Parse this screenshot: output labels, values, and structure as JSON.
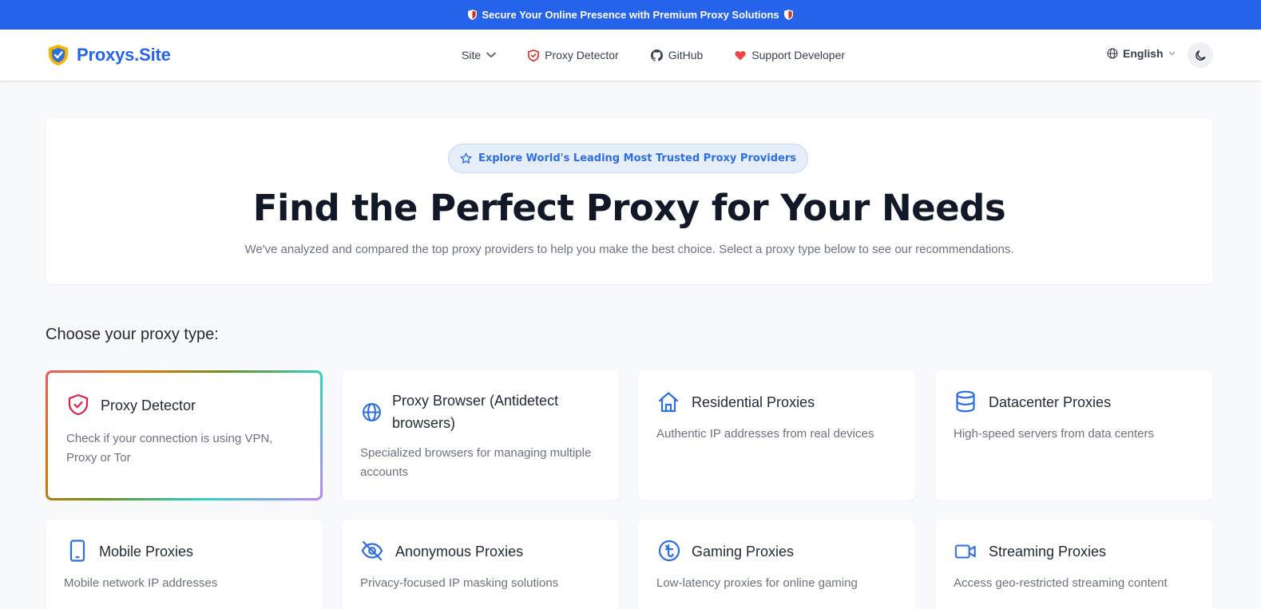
{
  "announcement": {
    "text": "Secure Your Online Presence with Premium Proxy Solutions"
  },
  "nav": {
    "brand": "Proxys.Site",
    "links": [
      {
        "label": "Site",
        "icon": "chevron-down-icon"
      },
      {
        "label": "Proxy Detector",
        "icon": "shield-icon"
      },
      {
        "label": "GitHub",
        "icon": "github-icon"
      },
      {
        "label": "Support Developer",
        "icon": "heart-icon"
      }
    ],
    "language": "English",
    "theme_icon": "moon-icon"
  },
  "hero": {
    "badge": "Explore World's Leading Most Trusted Proxy Providers",
    "title": "Find the Perfect Proxy for Your Needs",
    "subtitle": "We've analyzed and compared the top proxy providers to help you make the best choice. Select a proxy type below to see our recommendations."
  },
  "section_title": "Choose your proxy type:",
  "cards": [
    {
      "title": "Proxy Detector",
      "desc": "Check if your connection is using VPN, Proxy or Tor",
      "icon": "shield-check-icon"
    },
    {
      "title": "Proxy Browser (Antidetect browsers)",
      "desc": "Specialized browsers for managing multiple accounts",
      "icon": "globe-icon"
    },
    {
      "title": "Residential Proxies",
      "desc": "Authentic IP addresses from real devices",
      "icon": "home-icon"
    },
    {
      "title": "Datacenter Proxies",
      "desc": "High-speed servers from data centers",
      "icon": "database-icon"
    },
    {
      "title": "Mobile Proxies",
      "desc": "Mobile network IP addresses",
      "icon": "smartphone-icon"
    },
    {
      "title": "Anonymous Proxies",
      "desc": "Privacy-focused IP masking solutions",
      "icon": "eye-off-icon"
    },
    {
      "title": "Gaming Proxies",
      "desc": "Low-latency proxies for online gaming",
      "icon": "gaming-icon"
    },
    {
      "title": "Streaming Proxies",
      "desc": "Access geo-restricted streaming content",
      "icon": "video-icon"
    }
  ],
  "colors": {
    "accent": "#2563eb",
    "badge_bg": "#e6eefc",
    "heart": "#ef4444",
    "shield_red": "#dc2626"
  }
}
